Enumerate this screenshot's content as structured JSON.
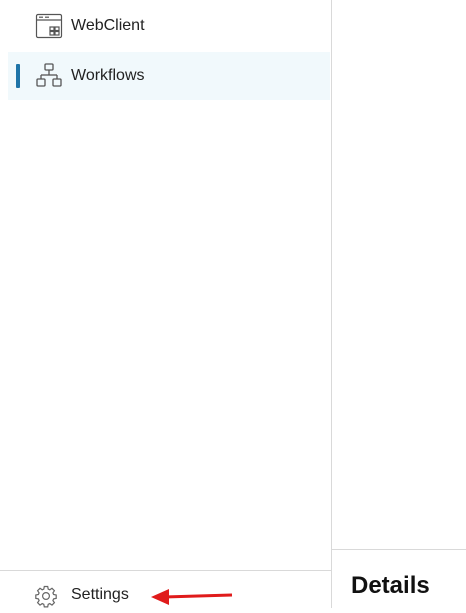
{
  "sidebar": {
    "items": [
      {
        "label": "WebClient",
        "icon": "webclient-window-icon",
        "active": false
      },
      {
        "label": "Workflows",
        "icon": "workflow-tree-icon",
        "active": true
      }
    ],
    "settings": {
      "label": "Settings",
      "icon": "gear-icon"
    }
  },
  "panel": {
    "title": "Details"
  },
  "annotation": {
    "arrow_color": "#e01b1b"
  },
  "colors": {
    "active_bar": "#1f74a8",
    "active_background": "#f1f9fc",
    "divider": "#d9d9d9",
    "text": "#222222"
  }
}
